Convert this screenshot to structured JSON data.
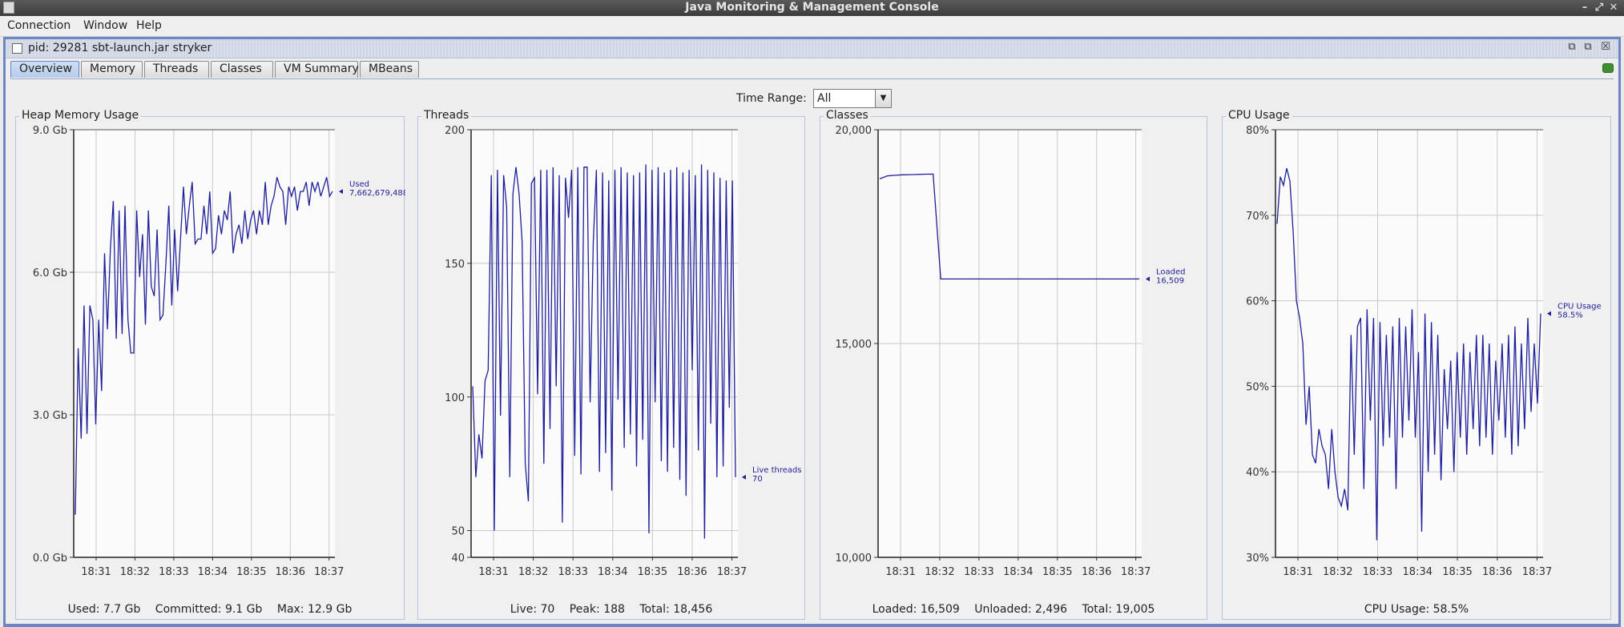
{
  "window": {
    "title": "Java Monitoring & Management Console",
    "menu": [
      "Connection",
      "Window",
      "Help"
    ],
    "controls": [
      "–",
      "⤢",
      "✕"
    ]
  },
  "connection": {
    "title": "pid: 29281 sbt-launch.jar stryker",
    "controls": [
      "⧉",
      "⧉",
      "☒"
    ]
  },
  "tabs": [
    "Overview",
    "Memory",
    "Threads",
    "Classes",
    "VM Summary",
    "MBeans"
  ],
  "active_tab": "Overview",
  "time_range": {
    "label": "Time Range:",
    "value": "All"
  },
  "colors": {
    "series": "#1f1f9a",
    "grid": "#c8c8c8",
    "accent": "#6b85c6"
  },
  "chart_data": [
    {
      "type": "line",
      "title": "Heap Memory Usage",
      "x": [
        "18:31",
        "18:32",
        "18:33",
        "18:34",
        "18:35",
        "18:36",
        "18:37"
      ],
      "ylim": [
        0,
        9
      ],
      "yticks": [
        "0.0 Gb",
        "3.0 Gb",
        "6.0 Gb",
        "9.0 Gb"
      ],
      "ytick_values": [
        0,
        3,
        6,
        9
      ],
      "series": [
        {
          "name": "Used",
          "last_label": "7,662,679,488",
          "values": [
            0.9,
            4.4,
            2.5,
            5.3,
            2.6,
            5.3,
            5.0,
            2.8,
            5.0,
            3.5,
            6.4,
            4.8,
            6.5,
            7.5,
            4.6,
            7.3,
            4.7,
            7.4,
            5.0,
            4.3,
            4.3,
            7.3,
            5.9,
            6.8,
            4.9,
            7.3,
            5.7,
            5.5,
            6.9,
            5.0,
            5.1,
            6.2,
            7.4,
            5.3,
            6.9,
            5.6,
            6.7,
            7.8,
            6.8,
            7.4,
            7.9,
            6.6,
            6.7,
            6.7,
            7.4,
            6.8,
            7.7,
            6.4,
            6.5,
            7.2,
            6.8,
            7.3,
            7.1,
            7.7,
            6.4,
            6.8,
            7.0,
            6.6,
            7.3,
            6.7,
            7.1,
            7.3,
            6.8,
            7.3,
            7.0,
            7.9,
            7.0,
            7.4,
            7.6,
            8.0,
            7.8,
            7.7,
            7.0,
            7.8,
            7.6,
            7.8,
            7.3,
            7.7,
            7.7,
            7.9,
            7.4,
            7.9,
            7.7,
            7.9,
            7.6,
            7.8,
            8.0,
            7.6,
            7.7
          ]
        }
      ],
      "footer": [
        "Used: 7.7 Gb",
        "Committed: 9.1 Gb",
        "Max: 12.9 Gb"
      ]
    },
    {
      "type": "line",
      "title": "Threads",
      "x": [
        "18:31",
        "18:32",
        "18:33",
        "18:34",
        "18:35",
        "18:36",
        "18:37"
      ],
      "ylim": [
        40,
        200
      ],
      "yticks": [
        "40",
        "50",
        "100",
        "150",
        "200"
      ],
      "ytick_values": [
        40,
        50,
        100,
        150,
        200
      ],
      "series": [
        {
          "name": "Live threads",
          "last_label": "70",
          "values": [
            104,
            70,
            86,
            77,
            106,
            110,
            183,
            50,
            185,
            93,
            183,
            171,
            70,
            176,
            186,
            176,
            158,
            75,
            61,
            180,
            182,
            101,
            185,
            75,
            185,
            88,
            186,
            104,
            183,
            53,
            182,
            167,
            185,
            78,
            186,
            71,
            186,
            186,
            98,
            158,
            185,
            72,
            184,
            79,
            181,
            65,
            185,
            99,
            186,
            81,
            184,
            86,
            183,
            74,
            184,
            84,
            187,
            49,
            185,
            98,
            186,
            76,
            184,
            72,
            185,
            81,
            186,
            69,
            184,
            63,
            185,
            110,
            183,
            80,
            187,
            47,
            185,
            90,
            184,
            70,
            182,
            74,
            181,
            96,
            181,
            70
          ]
        }
      ],
      "footer": [
        "Live: 70",
        "Peak: 188",
        "Total: 18,456"
      ]
    },
    {
      "type": "line",
      "title": "Classes",
      "x": [
        "18:31",
        "18:32",
        "18:33",
        "18:34",
        "18:35",
        "18:36",
        "18:37"
      ],
      "ylim": [
        10000,
        20000
      ],
      "yticks": [
        "10,000",
        "15,000",
        "20,000"
      ],
      "ytick_values": [
        10000,
        15000,
        20000
      ],
      "series": [
        {
          "name": "Loaded",
          "last_label": "16,509",
          "values": [
            18850,
            18920,
            18935,
            18945,
            18950,
            18955,
            18960,
            18962,
            16509,
            16509,
            16509,
            16509,
            16509,
            16509,
            16509,
            16509,
            16509,
            16509,
            16509,
            16509,
            16509,
            16509,
            16509,
            16509,
            16509,
            16509,
            16509,
            16509,
            16509,
            16509,
            16509,
            16509,
            16509,
            16509,
            16509
          ]
        }
      ],
      "footer": [
        "Loaded: 16,509",
        "Unloaded: 2,496",
        "Total: 19,005"
      ]
    },
    {
      "type": "line",
      "title": "CPU Usage",
      "x": [
        "18:31",
        "18:32",
        "18:33",
        "18:34",
        "18:35",
        "18:36",
        "18:37"
      ],
      "ylim": [
        30,
        80
      ],
      "yticks": [
        "30%",
        "40%",
        "50%",
        "60%",
        "70%",
        "80%"
      ],
      "ytick_values": [
        30,
        40,
        50,
        60,
        70,
        80
      ],
      "series": [
        {
          "name": "CPU Usage",
          "last_label": "58.5%",
          "values": [
            69,
            74.5,
            73.5,
            75.5,
            74,
            68,
            60,
            58,
            55,
            45.5,
            50,
            42,
            41,
            45,
            43,
            42,
            38,
            45,
            40,
            37,
            36,
            38,
            35.5,
            56,
            42,
            57,
            58,
            38,
            59,
            46,
            58,
            32,
            57.5,
            43,
            56,
            44,
            57,
            38,
            58,
            44,
            57,
            46,
            59,
            44,
            54,
            33,
            58.5,
            40,
            57.5,
            42,
            56,
            39,
            52,
            45,
            53,
            40,
            54,
            44,
            55,
            42,
            54,
            45,
            56,
            43,
            56,
            44,
            55,
            42,
            53,
            46,
            55,
            44,
            56,
            42,
            57,
            43,
            55,
            45,
            58,
            47,
            55,
            48,
            58.5
          ]
        }
      ],
      "footer": [
        "CPU Usage: 58.5%"
      ]
    }
  ]
}
